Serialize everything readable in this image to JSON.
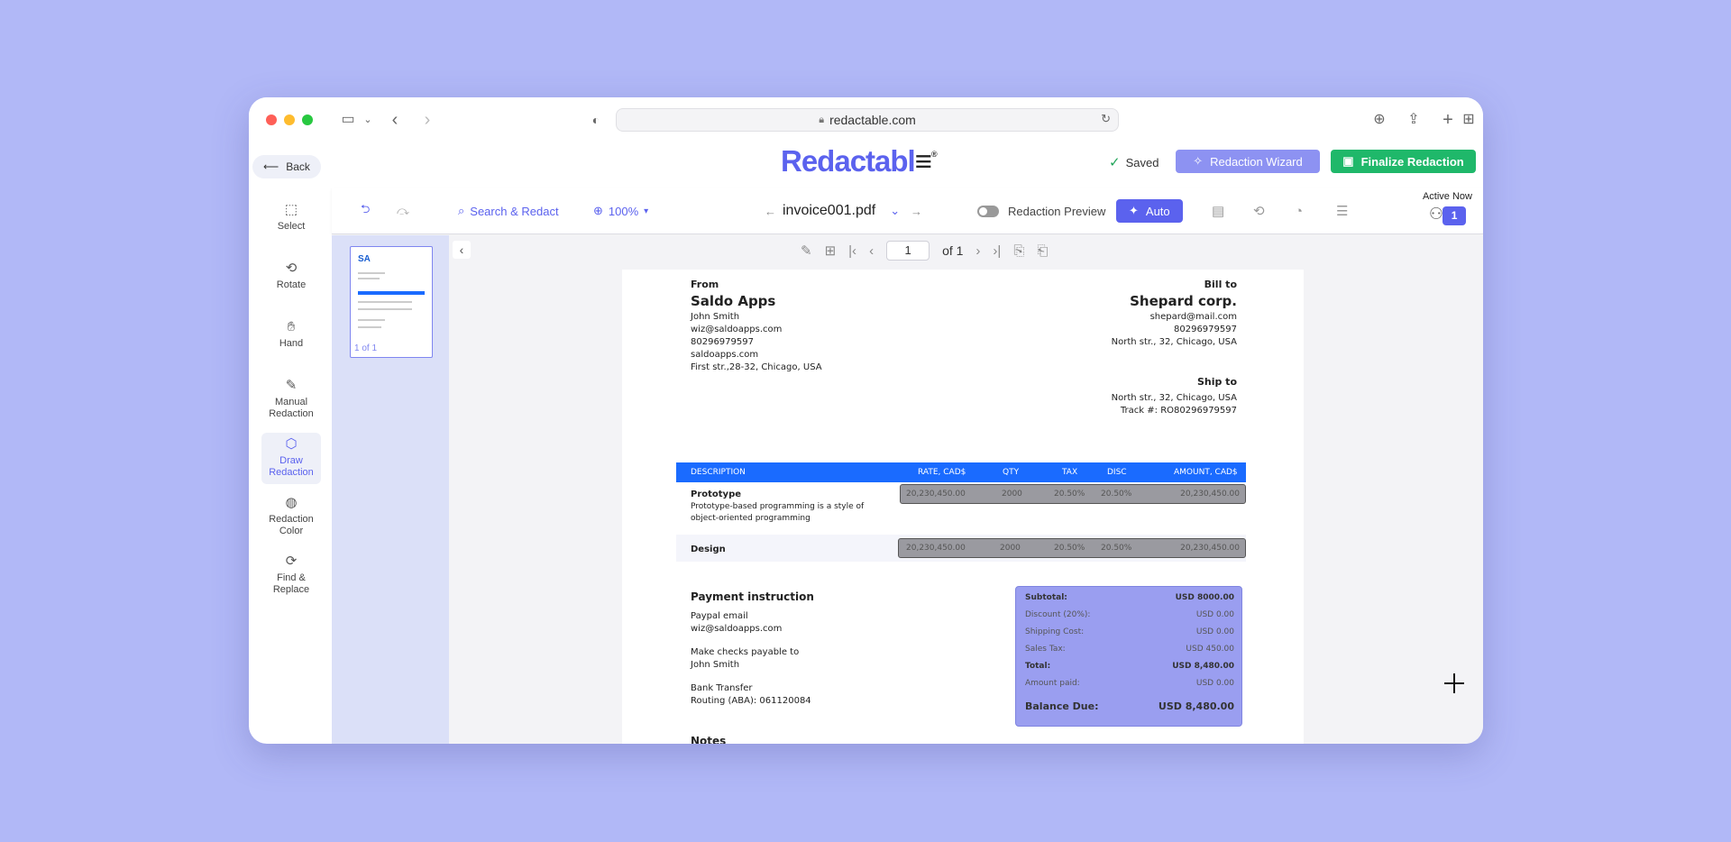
{
  "browser": {
    "url": "redactable.com"
  },
  "header": {
    "back_label": "Back",
    "logo_text": "Redactabl",
    "logo_mark": "®",
    "saved_label": "Saved",
    "wizard_label": "Redaction Wizard",
    "finalize_label": "Finalize Redaction",
    "colors": {
      "brand": "#5b62ee",
      "finalize": "#1fb86a",
      "wizard": "#8d92f2"
    }
  },
  "tools": [
    {
      "name": "select",
      "label": "Select",
      "icon": "cursor-icon"
    },
    {
      "name": "rotate",
      "label": "Rotate",
      "icon": "rotate-icon"
    },
    {
      "name": "hand",
      "label": "Hand",
      "icon": "hand-icon"
    },
    {
      "name": "manual-redaction",
      "label": "Manual Redaction",
      "icon": "pen-icon"
    },
    {
      "name": "draw-redaction",
      "label": "Draw Redaction",
      "icon": "cube-icon",
      "active": true
    },
    {
      "name": "redaction-color",
      "label": "Redaction Color",
      "icon": "palette-icon"
    },
    {
      "name": "find-replace",
      "label": "Find & Replace",
      "icon": "refresh-icon"
    }
  ],
  "toolbar": {
    "search_label": "Search & Redact",
    "zoom": "100%",
    "file_name": "invoice001.pdf",
    "preview_label": "Redaction Preview",
    "auto_label": "Auto",
    "active_now_label": "Active Now",
    "active_count": "1"
  },
  "thumbnails": {
    "label": "1 of 1",
    "thumb_logo": "SA"
  },
  "pager": {
    "current_page": "1",
    "of_label": "of 1"
  },
  "invoice": {
    "from_label": "From",
    "from_company": "Saldo Apps",
    "from_lines": [
      "John Smith",
      "wiz@saldoapps.com",
      "80296979597",
      "saldoapps.com",
      "First str.,28-32, Chicago, USA"
    ],
    "bill_label": "Bill to",
    "bill_company": "Shepard corp.",
    "bill_lines": [
      "shepard@mail.com",
      "80296979597",
      "North str., 32, Chicago, USA"
    ],
    "ship_label": "Ship to",
    "ship_lines": [
      "North str., 32, Chicago, USA",
      "Track #: RO80296979597"
    ],
    "columns": [
      "DESCRIPTION",
      "RATE, CAD$",
      "QTY",
      "TAX",
      "DISC",
      "AMOUNT, CAD$"
    ],
    "rows": [
      {
        "desc": "Prototype",
        "note": "Prototype-based programming is a style of object-oriented programming",
        "rate": "20,230,450.00",
        "qty": "2000",
        "tax": "20.50%",
        "disc": "20.50%",
        "amount": "20,230,450.00"
      },
      {
        "desc": "Design",
        "note": "",
        "rate": "20,230,450.00",
        "qty": "2000",
        "tax": "20.50%",
        "disc": "20.50%",
        "amount": "20,230,450.00"
      }
    ],
    "payment_title": "Payment instruction",
    "payment_lines": [
      "Paypal email",
      "wiz@saldoapps.com",
      "Make checks payable to",
      "John Smith",
      "Bank Transfer",
      "Routing (ABA): 061120084"
    ],
    "notes_title": "Notes",
    "totals": [
      {
        "label": "Subtotal:",
        "value": "USD 8000.00",
        "strong": true
      },
      {
        "label": "Discount (20%):",
        "value": "USD 0.00"
      },
      {
        "label": "Shipping Cost:",
        "value": "USD 0.00"
      },
      {
        "label": "Sales Tax:",
        "value": "USD 450.00"
      },
      {
        "label": "Total:",
        "value": "USD 8,480.00",
        "strong": true
      },
      {
        "label": "Amount paid:",
        "value": "USD 0.00"
      }
    ],
    "balance_label": "Balance Due:",
    "balance_value": "USD 8,480.00",
    "colors": {
      "table_head": "#1a6bff",
      "redaction_box": "#9a9aa0",
      "totals_box": "#9a9ef0"
    }
  }
}
